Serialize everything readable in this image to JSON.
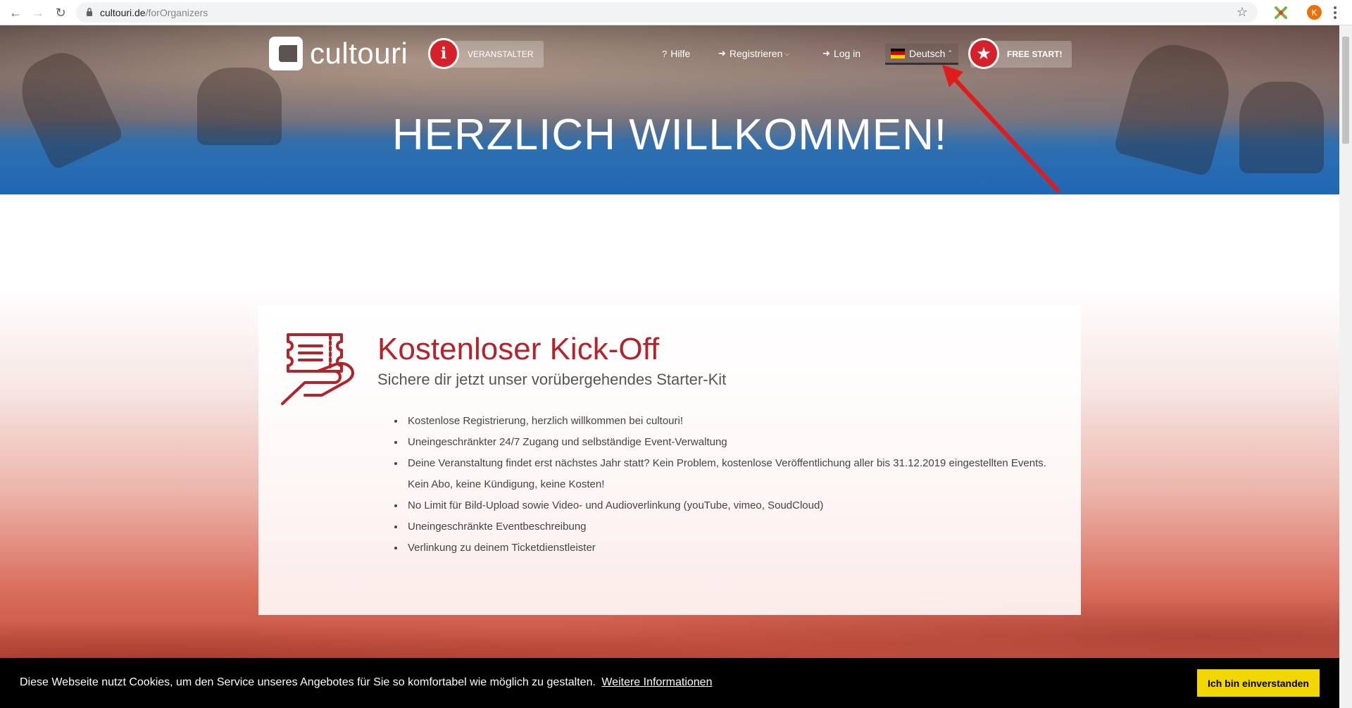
{
  "browser": {
    "url_host": "cultouri.de",
    "url_path": "/forOrganizers",
    "profile_initial": "K"
  },
  "header": {
    "logo_text": "cultouri",
    "organizer_label": "VERANSTALTER",
    "nav": {
      "help": "Hilfe",
      "register": "Registrieren",
      "login": "Log in",
      "language": "Deutsch"
    },
    "free_start_label": "FREE START!",
    "hero_title": "HERZLICH WILLKOMMEN!"
  },
  "card": {
    "title": "Kostenloser Kick-Off",
    "subtitle": "Sichere dir jetzt unser vorübergehendes Starter-Kit",
    "items": [
      "Kostenlose Registrierung, herzlich willkommen bei cultouri!",
      "Uneingeschränkter 24/7 Zugang und selbständige Event-Verwaltung",
      "Deine Veranstaltung findet erst nächstes Jahr statt? Kein Problem, kostenlose Veröffentlichung aller bis 31.12.2019 eingestellten Events. Kein Abo, keine Kündigung, keine Kosten!",
      "No Limit für Bild-Upload sowie Video- und Audioverlinkung (youTube, vimeo, SoudCloud)",
      "Uneingeschränkte Eventbeschreibung",
      "Verlinkung zu deinem Ticketdienstleister"
    ]
  },
  "cookie": {
    "text": "Diese Webseite nutzt Cookies, um den Service unseres Angebotes für Sie so komfortabel wie möglich zu gestalten.",
    "link": "Weitere Informationen",
    "accept": "Ich bin einverstanden"
  },
  "colors": {
    "brand_red": "#b3232a",
    "badge_red": "#d6212b",
    "hero_blue": "#1f67b5",
    "cookie_button": "#f1d600"
  },
  "icons": [
    "back-icon",
    "forward-icon",
    "reload-icon",
    "lock-icon",
    "star-icon",
    "extension-icon",
    "menu-icon",
    "info-icon",
    "question-icon",
    "sign-in-icon",
    "flag-de-icon",
    "star-badge-icon",
    "ticket-hand-icon"
  ]
}
